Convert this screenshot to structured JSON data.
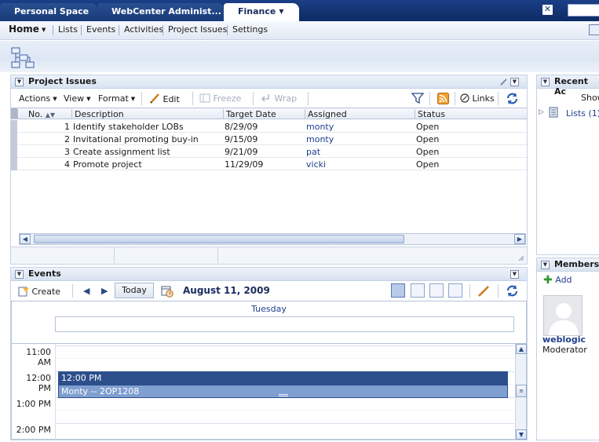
{
  "tabs": [
    {
      "label": "Personal Space"
    },
    {
      "label": "WebCenter Administ..."
    },
    {
      "label": "Finance"
    }
  ],
  "nav": {
    "home": "Home",
    "items": [
      "Lists",
      "Events",
      "Activities",
      "Project Issues",
      "Settings"
    ]
  },
  "project_issues": {
    "title": "Project Issues",
    "toolbar": {
      "actions": "Actions",
      "view": "View",
      "format": "Format",
      "edit": "Edit",
      "freeze": "Freeze",
      "wrap": "Wrap",
      "links": "Links"
    },
    "columns": [
      "No.",
      "Description",
      "Target Date",
      "Assigned",
      "Status"
    ],
    "rows": [
      {
        "no": "1",
        "description": "Identify stakeholder LOBs",
        "target_date": "8/29/09",
        "assigned": "monty",
        "status": "Open"
      },
      {
        "no": "2",
        "description": "Invitational promoting buy-in",
        "target_date": "9/15/09",
        "assigned": "monty",
        "status": "Open"
      },
      {
        "no": "3",
        "description": "Create assignment list",
        "target_date": "9/21/09",
        "assigned": "pat",
        "status": "Open"
      },
      {
        "no": "4",
        "description": "Promote project",
        "target_date": "11/29/09",
        "assigned": "vicki",
        "status": "Open"
      }
    ]
  },
  "events": {
    "title": "Events",
    "create": "Create",
    "today": "Today",
    "date": "August 11, 2009",
    "day": "Tuesday",
    "hours": [
      "11:00 AM",
      "12:00 PM",
      "1:00 PM",
      "2:00 PM"
    ],
    "event": {
      "time": "12:00 PM",
      "title": "Monty -- 2OP1208"
    }
  },
  "recent_activities": {
    "title": "Recent Ac",
    "show": "Show",
    "lists_link": "Lists (1)"
  },
  "members": {
    "title": "Members",
    "add": "Add",
    "name": "weblogic",
    "role": "Moderator"
  },
  "colors": {
    "brand_dark": "#0d2a63",
    "link": "#1e3e8c",
    "event_fill": "#7f9fd0",
    "event_header": "#2c4f8c"
  }
}
